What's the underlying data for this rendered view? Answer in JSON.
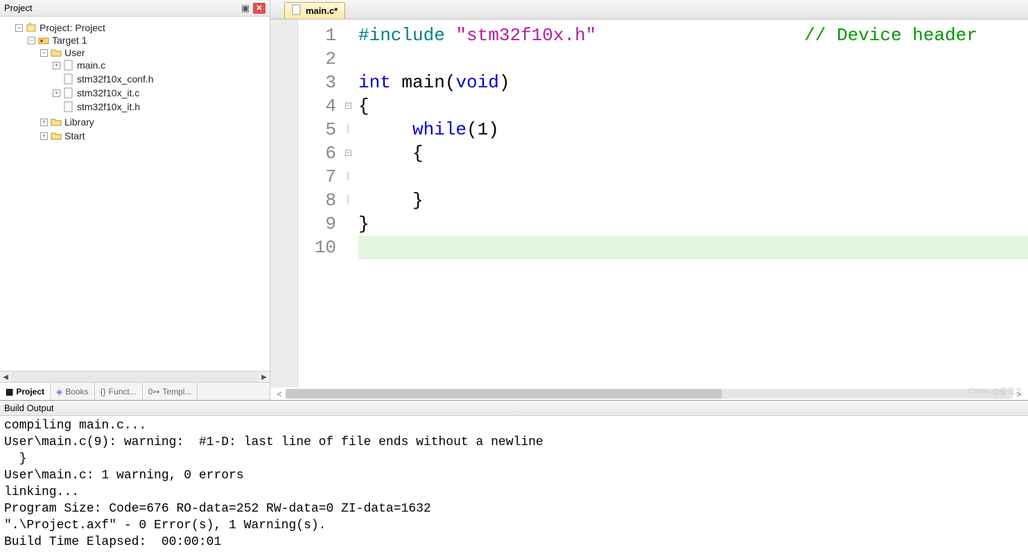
{
  "project_panel": {
    "title": "Project",
    "root": {
      "label": "Project: Project"
    },
    "target": {
      "label": "Target 1"
    },
    "folders": {
      "user": {
        "label": "User",
        "files": [
          "main.c",
          "stm32f10x_conf.h",
          "stm32f10x_it.c",
          "stm32f10x_it.h"
        ]
      },
      "library": {
        "label": "Library"
      },
      "start": {
        "label": "Start"
      }
    },
    "tabs": [
      "Project",
      "Books",
      "Funct...",
      "Templ..."
    ]
  },
  "editor": {
    "tab_label": "main.c*",
    "line_numbers": [
      "1",
      "2",
      "3",
      "4",
      "5",
      "6",
      "7",
      "8",
      "9",
      "10"
    ],
    "code": {
      "l1_pp": "#include",
      "l1_str": "\"stm32f10x.h\"",
      "l1_cmt": "// Device header",
      "l3_kw1": "int",
      "l3_id": " main(",
      "l3_kw2": "void",
      "l3_tail": ")",
      "l4": "{",
      "l5_ind": "     ",
      "l5_kw": "while",
      "l5_tail": "(1)",
      "l6": "     {",
      "l8": "     }",
      "l9": "}"
    }
  },
  "build": {
    "title": "Build Output",
    "lines": [
      "compiling main.c...",
      "User\\main.c(9): warning:  #1-D: last line of file ends without a newline",
      "  }",
      "User\\main.c: 1 warning, 0 errors",
      "linking...",
      "Program Size: Code=676 RO-data=252 RW-data=0 ZI-data=1632",
      "\".\\Project.axf\" - 0 Error(s), 1 Warning(s).",
      "Build Time Elapsed:  00:00:01"
    ]
  },
  "watermark": "CSDN @星云之"
}
